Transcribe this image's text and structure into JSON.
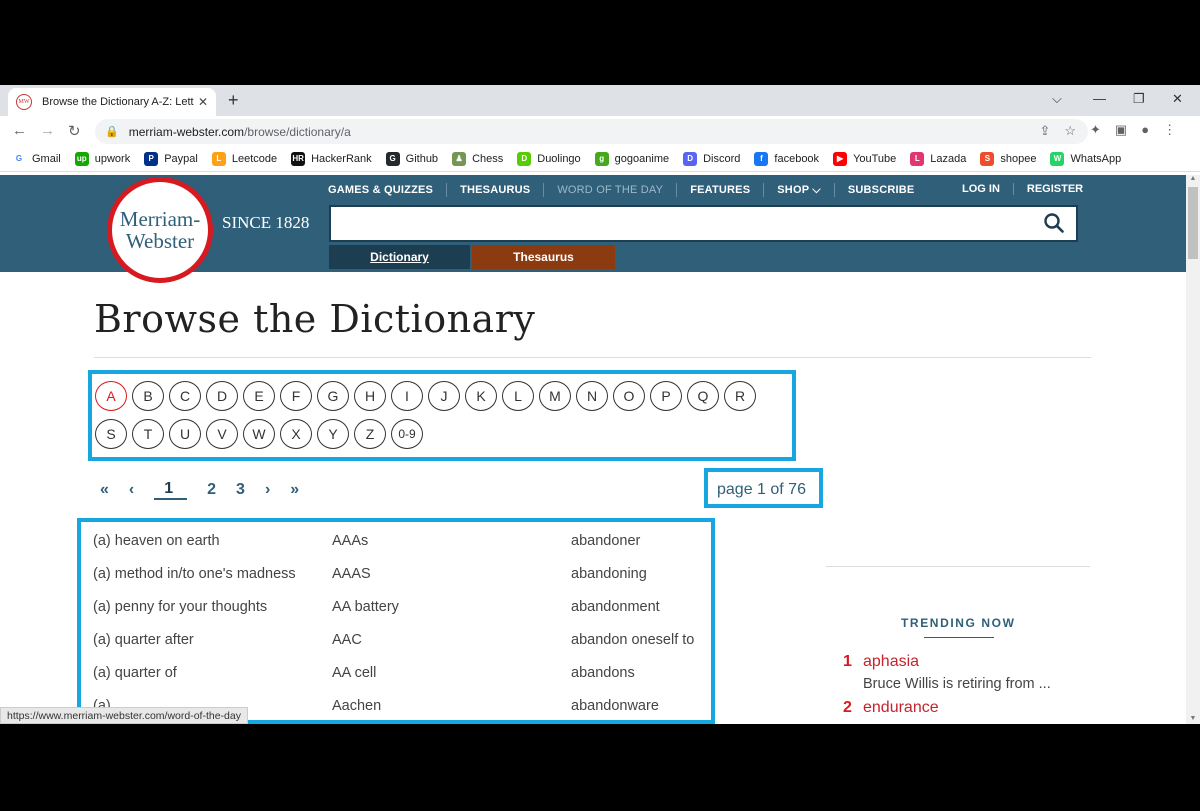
{
  "browser": {
    "tab_title": "Browse the Dictionary A-Z: Lette",
    "favicon_text": "MW",
    "url_host": "merriam-webster.com",
    "url_path": "/browse/dictionary/a",
    "bookmarks": [
      {
        "label": "Gmail",
        "icon": "gmail-icon",
        "color": "#ffffff",
        "glyph": "G"
      },
      {
        "label": "upwork",
        "icon": "upwork-icon",
        "color": "#14a800",
        "glyph": "up"
      },
      {
        "label": "Paypal",
        "icon": "paypal-icon",
        "color": "#003087",
        "glyph": "P"
      },
      {
        "label": "Leetcode",
        "icon": "leetcode-icon",
        "color": "#ffa116",
        "glyph": "L"
      },
      {
        "label": "HackerRank",
        "icon": "hackerrank-icon",
        "color": "#111111",
        "glyph": "HR"
      },
      {
        "label": "Github",
        "icon": "github-icon",
        "color": "#24292e",
        "glyph": "G"
      },
      {
        "label": "Chess",
        "icon": "chess-icon",
        "color": "#769656",
        "glyph": "♟"
      },
      {
        "label": "Duolingo",
        "icon": "duolingo-icon",
        "color": "#58cc02",
        "glyph": "D"
      },
      {
        "label": "gogoanime",
        "icon": "gogoanime-icon",
        "color": "#46a81f",
        "glyph": "g"
      },
      {
        "label": "Discord",
        "icon": "discord-icon",
        "color": "#5865f2",
        "glyph": "D"
      },
      {
        "label": "facebook",
        "icon": "facebook-icon",
        "color": "#1877f2",
        "glyph": "f"
      },
      {
        "label": "YouTube",
        "icon": "youtube-icon",
        "color": "#ff0000",
        "glyph": "▶"
      },
      {
        "label": "Lazada",
        "icon": "lazada-icon",
        "color": "#e1366f",
        "glyph": "L"
      },
      {
        "label": "shopee",
        "icon": "shopee-icon",
        "color": "#ee4d2d",
        "glyph": "S"
      },
      {
        "label": "WhatsApp",
        "icon": "whatsapp-icon",
        "color": "#25d366",
        "glyph": "W"
      }
    ]
  },
  "header": {
    "logo_line1": "Merriam-",
    "logo_line2": "Webster",
    "since": "SINCE 1828",
    "nav": [
      "GAMES & QUIZZES",
      "THESAURUS",
      "WORD OF THE DAY",
      "FEATURES",
      "SHOP ⌵",
      "SUBSCRIBE"
    ],
    "login": "LOG IN",
    "register": "REGISTER",
    "tab_dictionary": "Dictionary",
    "tab_thesaurus": "Thesaurus"
  },
  "main": {
    "title": "Browse the Dictionary",
    "letters": [
      "A",
      "B",
      "C",
      "D",
      "E",
      "F",
      "G",
      "H",
      "I",
      "J",
      "K",
      "L",
      "M",
      "N",
      "O",
      "P",
      "Q",
      "R",
      "S",
      "T",
      "U",
      "V",
      "W",
      "X",
      "Y",
      "Z",
      "0-9"
    ],
    "active_letter": "A",
    "pager": {
      "first": "«",
      "prev": "‹",
      "pages": [
        "1",
        "2",
        "3"
      ],
      "next": "›",
      "last": "»",
      "current": "1"
    },
    "page_info": "page 1 of 76",
    "words": [
      "(a) heaven on earth",
      "AAAs",
      "abandoner",
      "(a) method in/to one's madness",
      "AAAS",
      "abandoning",
      "(a) penny for your thoughts",
      "AA battery",
      "abandonment",
      "(a) quarter after",
      "AAC",
      "abandon oneself to",
      "(a) quarter of",
      "AA cell",
      "abandons",
      "(a)...",
      "Aachen",
      "abandonware"
    ]
  },
  "sidebar": {
    "trending_label": "TRENDING NOW",
    "items": [
      {
        "num": "1",
        "word": "aphasia",
        "desc": "Bruce Willis is retiring from ..."
      },
      {
        "num": "2",
        "word": "endurance",
        "desc": ""
      }
    ]
  },
  "status_url": "https://www.merriam-webster.com/word-of-the-day",
  "colors": {
    "mw_blue": "#305f7a",
    "mw_red": "#d71920",
    "highlight": "#16a6e0"
  }
}
